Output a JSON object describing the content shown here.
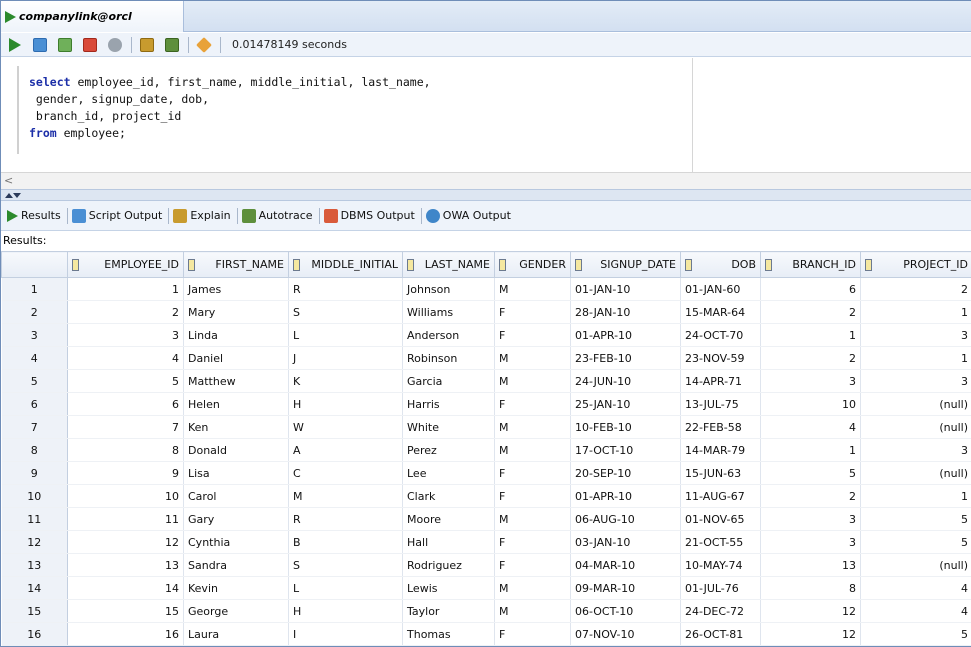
{
  "connection_tab": {
    "label": "companylink@orcl"
  },
  "toolbar": {
    "elapsed": "0.01478149 seconds"
  },
  "editor": {
    "lines": [
      {
        "kw": "select",
        "rest": " employee_id, first_name, middle_initial, last_name,"
      },
      {
        "kw": "",
        "rest": " gender, signup_date, dob,"
      },
      {
        "kw": "",
        "rest": " branch_id, project_id"
      },
      {
        "kw": "from",
        "rest": " employee;"
      }
    ],
    "scroll_left": "<"
  },
  "output_tabs": [
    "Results",
    "Script Output",
    "Explain",
    "Autotrace",
    "DBMS Output",
    "OWA Output"
  ],
  "results_label": "Results:",
  "columns": [
    "EMPLOYEE_ID",
    "FIRST_NAME",
    "MIDDLE_INITIAL",
    "LAST_NAME",
    "GENDER",
    "SIGNUP_DATE",
    "DOB",
    "BRANCH_ID",
    "PROJECT_ID"
  ],
  "rows": [
    [
      "1",
      "1",
      "James",
      "R",
      "Johnson",
      "M",
      "01-JAN-10",
      "01-JAN-60",
      "6",
      "2"
    ],
    [
      "2",
      "2",
      "Mary",
      "S",
      "Williams",
      "F",
      "28-JAN-10",
      "15-MAR-64",
      "2",
      "1"
    ],
    [
      "3",
      "3",
      "Linda",
      "L",
      "Anderson",
      "F",
      "01-APR-10",
      "24-OCT-70",
      "1",
      "3"
    ],
    [
      "4",
      "4",
      "Daniel",
      "J",
      "Robinson",
      "M",
      "23-FEB-10",
      "23-NOV-59",
      "2",
      "1"
    ],
    [
      "5",
      "5",
      "Matthew",
      "K",
      "Garcia",
      "M",
      "24-JUN-10",
      "14-APR-71",
      "3",
      "3"
    ],
    [
      "6",
      "6",
      "Helen",
      "H",
      "Harris",
      "F",
      "25-JAN-10",
      "13-JUL-75",
      "10",
      "(null)"
    ],
    [
      "7",
      "7",
      "Ken",
      "W",
      "White",
      "M",
      "10-FEB-10",
      "22-FEB-58",
      "4",
      "(null)"
    ],
    [
      "8",
      "8",
      "Donald",
      "A",
      "Perez",
      "M",
      "17-OCT-10",
      "14-MAR-79",
      "1",
      "3"
    ],
    [
      "9",
      "9",
      "Lisa",
      "C",
      "Lee",
      "F",
      "20-SEP-10",
      "15-JUN-63",
      "5",
      "(null)"
    ],
    [
      "10",
      "10",
      "Carol",
      "M",
      "Clark",
      "F",
      "01-APR-10",
      "11-AUG-67",
      "2",
      "1"
    ],
    [
      "11",
      "11",
      "Gary",
      "R",
      "Moore",
      "M",
      "06-AUG-10",
      "01-NOV-65",
      "3",
      "5"
    ],
    [
      "12",
      "12",
      "Cynthia",
      "B",
      "Hall",
      "F",
      "03-JAN-10",
      "21-OCT-55",
      "3",
      "5"
    ],
    [
      "13",
      "13",
      "Sandra",
      "S",
      "Rodriguez",
      "F",
      "04-MAR-10",
      "10-MAY-74",
      "13",
      "(null)"
    ],
    [
      "14",
      "14",
      "Kevin",
      "L",
      "Lewis",
      "M",
      "09-MAR-10",
      "01-JUL-76",
      "8",
      "4"
    ],
    [
      "15",
      "15",
      "George",
      "H",
      "Taylor",
      "M",
      "06-OCT-10",
      "24-DEC-72",
      "12",
      "4"
    ],
    [
      "16",
      "16",
      "Laura",
      "I",
      "Thomas",
      "F",
      "07-NOV-10",
      "26-OCT-81",
      "12",
      "5"
    ]
  ],
  "icon_colors": {
    "run": "#2c8a2c",
    "commit": "#4a8fd4",
    "rollback": "#d94a3a",
    "cancel": "#9aa3ad",
    "explain": "#c89b2e",
    "autotrace": "#5e8f3c",
    "clear": "#e8a23a"
  }
}
